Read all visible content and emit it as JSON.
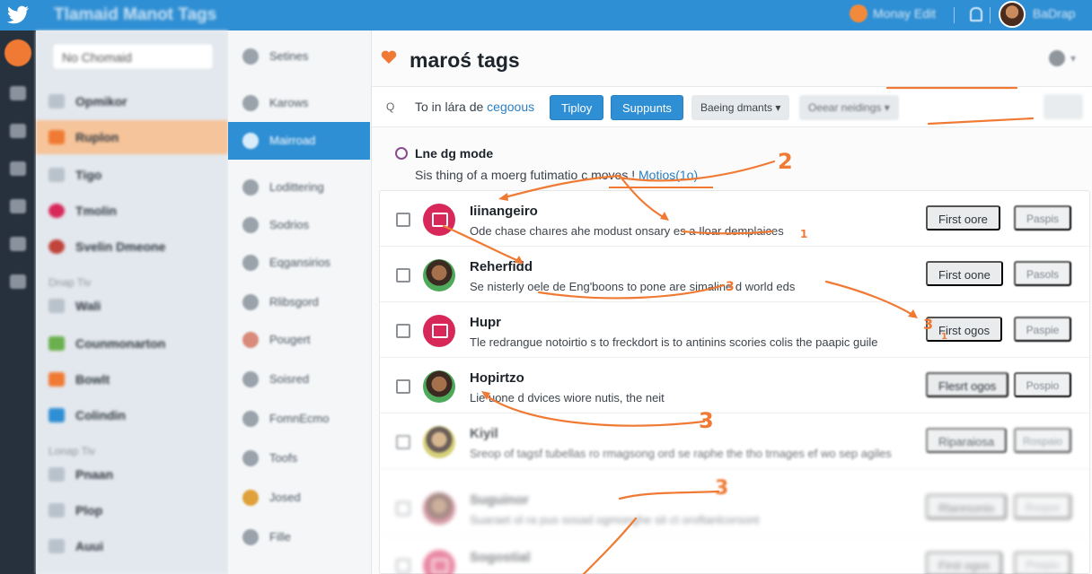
{
  "topbar": {
    "app_title": "Tlamaid Manot Tags",
    "top_link": "Monay Edit",
    "user_name": "BaDrap"
  },
  "nav1": {
    "search_placeholder": "No Chomaid",
    "items": [
      "Opmikor",
      "Ruplon",
      "Tigo",
      "Tmolin",
      "Svelin Dmeone",
      "Wali",
      "Counmonarton",
      "Bowlt",
      "Colindin",
      "Pnaan",
      "Plop",
      "Auui"
    ],
    "groups": [
      "Dnap Tiv",
      "Lonap Tiv"
    ]
  },
  "nav2": {
    "header": "Setines",
    "items": [
      "Karows",
      "Mairroad",
      "Lodittering",
      "Sodrios",
      "Eqgansirios",
      "Rlibsgord",
      "Pougert",
      "Soisred",
      "FomnEcmo",
      "Toofs",
      "Josed",
      "Fille"
    ]
  },
  "main": {
    "title": "maroś tags",
    "toolbar": {
      "q": "Q",
      "filter_prefix": "To in lára de ",
      "filter_link": "cegoous",
      "btn_tiploy": "Tiploy",
      "btn_suppunts": "Suppunts",
      "dropdown_1": "Baeing dmants",
      "dropdown_2": "Oeear neidings",
      "chevron": "▾"
    },
    "info": {
      "title": "Lne dg mode",
      "desc_prefix": "Sis thing of a moerg futimatio c moves ! ",
      "desc_link": "Motios(1o)"
    },
    "rows": [
      {
        "name": "Iiinangeiro",
        "desc": "Ode chase chaıres ahe modust onsary es a Iloar demplaices",
        "b1": "First oore",
        "b2": "Paspis"
      },
      {
        "name": "Reherfidd",
        "desc": "Se nisterly oele de Eng'boons to pone are simaline d world eds",
        "b1": "First oone",
        "b2": "Pasols"
      },
      {
        "name": "Hupr",
        "desc": "Tle redrangue notoirtio s to freckdort is to antinins scories colis the paapic guile",
        "b1": "First ogos",
        "b2": "Paspie"
      },
      {
        "name": "Hopirtzo",
        "desc": "Lie uone d dvices wiore nutis, the neit",
        "b1": "Flesrt ogos",
        "b2": "Pospio"
      },
      {
        "name": "Kiyil",
        "desc": "Sreop of tagsf tubellas ro rmagsong ord se raphe the tho trnages ef wo sep agiles",
        "b1": "Riparaiosa",
        "b2": "Rospaio"
      },
      {
        "name": "Suguinor",
        "desc": "Suaraet ol ra pus sosad ogmonghe sit ct oroftanlcorsont",
        "b1": "Rlaresonio",
        "b2": "Rospor"
      },
      {
        "name": "Sogostial",
        "desc": "",
        "b1": "First ogos",
        "b2": "Pospio"
      }
    ]
  },
  "annotations": [
    "2",
    "1",
    "3",
    "3",
    "1",
    "3",
    "3"
  ],
  "colors": {
    "accent": "#f07a33",
    "primary": "#2f8fd4",
    "avatar_pink": "#d8285a"
  }
}
